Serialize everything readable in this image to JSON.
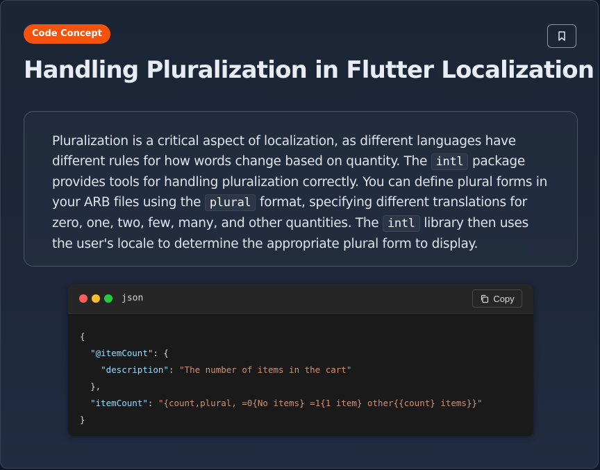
{
  "badge": "Code Concept",
  "title": "Handling Pluralization in Flutter Localization",
  "bookmark_icon": "bookmark-icon",
  "description": {
    "part1": "Pluralization is a critical aspect of localization, as different languages have different rules for how words change based on quantity. The ",
    "code1": "intl",
    "part2": " package provides tools for handling pluralization correctly. You can define plural forms in your ARB files using the ",
    "code2": "plural",
    "part3": " format, specifying different translations for zero, one, two, few, many, and other quantities. The ",
    "code3": "intl",
    "part4": " library then uses the user's locale to determine the appropriate plural form to display."
  },
  "code_block": {
    "language": "json",
    "copy_label": "Copy",
    "lines": {
      "l1": "{",
      "l2_key": "\"@itemCount\"",
      "l2_rest": ": {",
      "l3_key": "\"description\"",
      "l3_sep": ": ",
      "l3_val": "\"The number of items in the cart\"",
      "l4": "},",
      "l5_key": "\"itemCount\"",
      "l5_sep": ": ",
      "l5_val": "\"{count,plural, =0{No items} =1{1 item} other{{count} items}}\"",
      "l6": "}"
    }
  },
  "colors": {
    "badge": "#f5520c",
    "json_key": "#9cdcfe",
    "json_string": "#ce9178"
  }
}
